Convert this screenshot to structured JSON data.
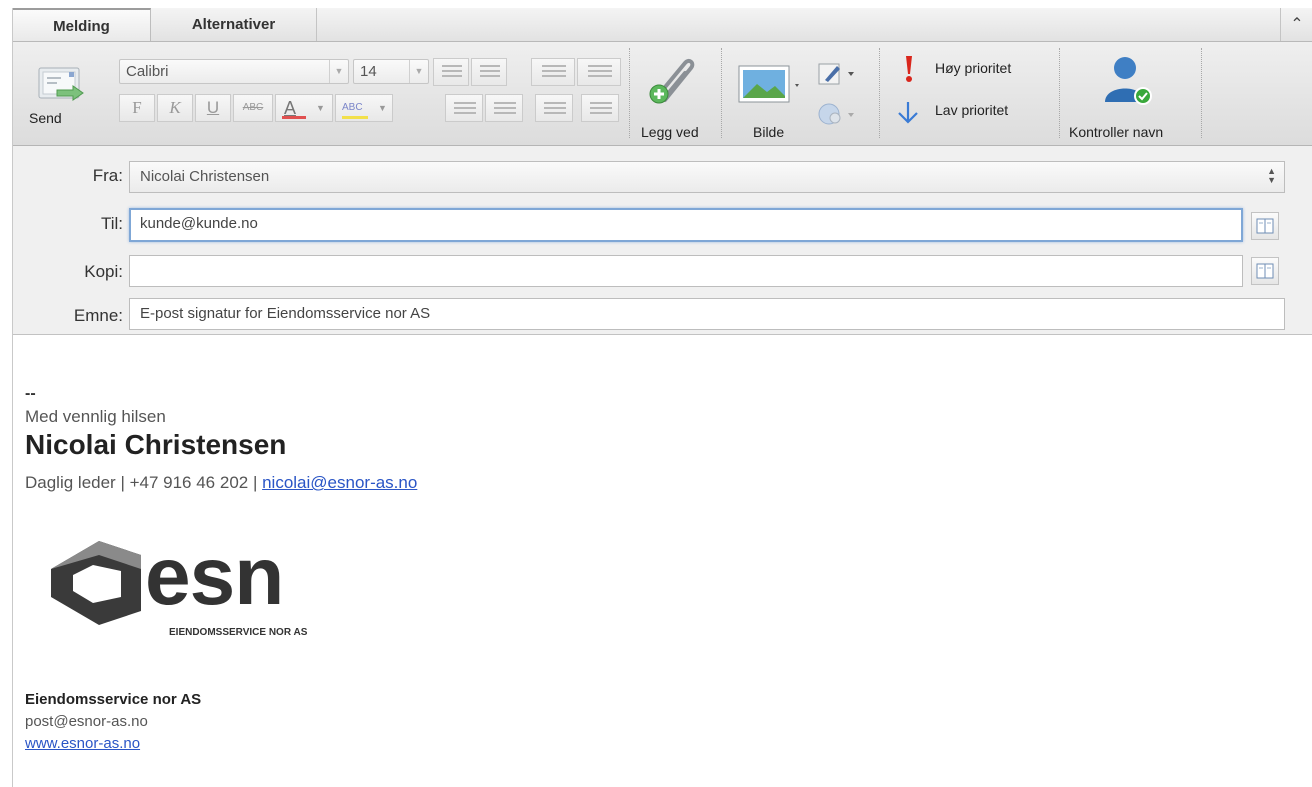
{
  "tabs": [
    "Melding",
    "Alternativer"
  ],
  "collapse_icon": "chevron-up-icon",
  "toolbar": {
    "send_label": "Send",
    "font_name": "Calibri",
    "font_size": "14",
    "bold_label": "F",
    "italic_label": "K",
    "underline_label": "U",
    "strike_label": "ABC",
    "color_label": "A",
    "highlight_label": "ABC",
    "attach_label": "Legg ved",
    "image_label": "Bilde",
    "high_priority_label": "Høy prioritet",
    "low_priority_label": "Lav prioritet",
    "check_names_label": "Kontroller navn",
    "colors": {
      "font_color_bar": "#e05050",
      "highlight_bar": "#f2e04a",
      "high_priority": "#d9261c",
      "low_priority": "#3a7bd5",
      "check_ok": "#39a83b"
    }
  },
  "header": {
    "from_label": "Fra:",
    "from_value": "Nicolai Christensen",
    "to_label": "Til:",
    "to_value": "kunde@kunde.no",
    "cc_label": "Kopi:",
    "cc_value": "",
    "subject_label": "Emne:",
    "subject_value": "E-post signatur for Eiendomsservice nor AS"
  },
  "body": {
    "dashes": "--",
    "greeting": "Med vennlig hilsen",
    "name": "Nicolai Christensen",
    "role_line_prefix": "Daglig leder | +47 916 46 202 | ",
    "email_link": "nicolai@esnor-as.no",
    "logo": {
      "text": "esn",
      "subtitle": "EIENDOMSSERVICE NOR AS"
    },
    "company_name": "Eiendomsservice nor AS",
    "company_email": "post@esnor-as.no",
    "company_web": "www.esnor-as.no",
    "link_color": "#2a55c6"
  }
}
